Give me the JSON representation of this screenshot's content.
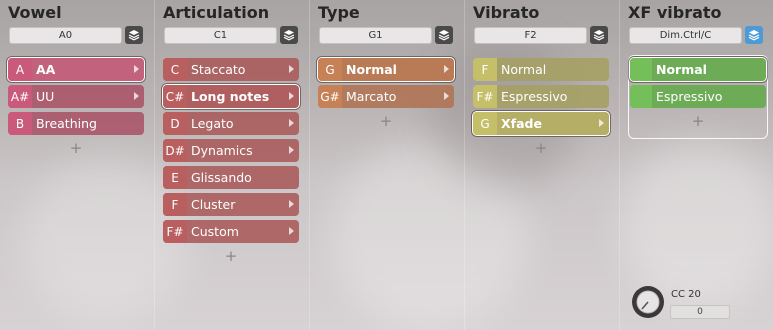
{
  "columns": [
    {
      "title": "Vowel",
      "key_value": "A0",
      "items": [
        {
          "key": "A",
          "label": "AA",
          "selected": true
        },
        {
          "key": "A#",
          "label": "UU"
        },
        {
          "key": "B",
          "label": "Breathing"
        }
      ],
      "add_label": "+"
    },
    {
      "title": "Articulation",
      "key_value": "C1",
      "items": [
        {
          "key": "C",
          "label": "Staccato"
        },
        {
          "key": "C#",
          "label": "Long notes",
          "selected": true
        },
        {
          "key": "D",
          "label": "Legato"
        },
        {
          "key": "D#",
          "label": "Dynamics"
        },
        {
          "key": "E",
          "label": "Glissando"
        },
        {
          "key": "F",
          "label": "Cluster"
        },
        {
          "key": "F#",
          "label": "Custom"
        }
      ],
      "add_label": "+"
    },
    {
      "title": "Type",
      "key_value": "G1",
      "items": [
        {
          "key": "G",
          "label": "Normal",
          "selected": true
        },
        {
          "key": "G#",
          "label": "Marcato"
        }
      ],
      "add_label": "+"
    },
    {
      "title": "Vibrato",
      "key_value": "F2",
      "items": [
        {
          "key": "F",
          "label": "Normal"
        },
        {
          "key": "F#",
          "label": "Espressivo"
        },
        {
          "key": "G",
          "label": "Xfade",
          "selected": true
        }
      ],
      "add_label": "+"
    },
    {
      "title": "XF vibrato",
      "key_value": "Dim.Ctrl/C",
      "items": [
        {
          "key": "",
          "label": "Normal",
          "selected": true
        },
        {
          "key": "",
          "label": "Espressivo"
        }
      ],
      "add_label": "+"
    }
  ],
  "cc": {
    "label": "CC 20",
    "value": "0"
  },
  "icons": {
    "layers": "layers-icon",
    "arrow": "chevron-right-icon",
    "knob": "knob-icon"
  },
  "colors": {
    "vowel": "#c95a7c",
    "articulation": "#b95f5f",
    "type": "#c68156",
    "vibrato": "#c6bf6a",
    "xf": "#74bf5a",
    "active_layer": "#4d9bd6"
  }
}
